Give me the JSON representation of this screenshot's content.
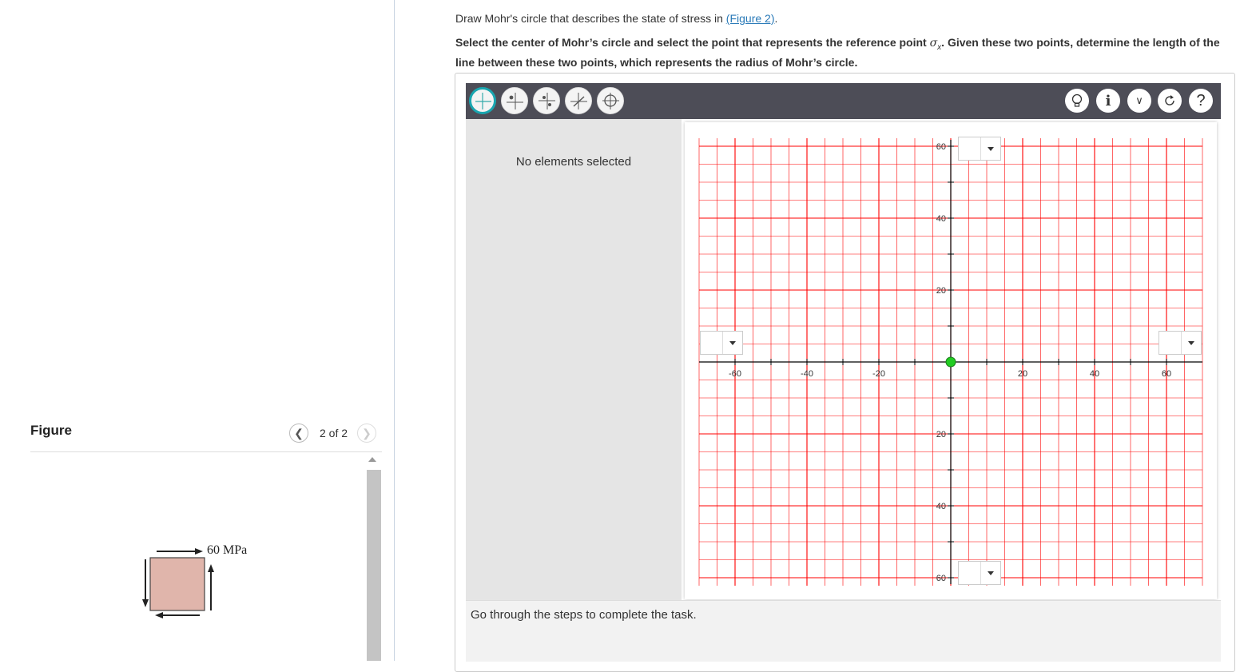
{
  "question": {
    "intro_before": "Draw Mohr's circle that describes the state of stress in ",
    "figure_link": "(Figure 2)",
    "intro_after": ".",
    "instruction_a": "Select the center of Mohr’s circle and select the point that represents the reference point ",
    "instruction_sym": "σ",
    "instruction_sub": "x",
    "instruction_b": ". Given these two points, determine the length of the line between these two points, which represents the radius of Mohr’s circle."
  },
  "figure_panel": {
    "title": "Figure",
    "counter": "2 of 2",
    "prev_icon": "chevron-left-icon",
    "next_icon": "chevron-right-icon",
    "stress_label": "60 MPa",
    "element_color": "#e0b5ab"
  },
  "toolbar": {
    "tools": [
      "axes-tool-icon",
      "point-tool-icon",
      "center-tool-icon",
      "segment-tool-icon",
      "circle-tool-icon"
    ],
    "right_tools": [
      "hint-bulb-icon",
      "info-icon",
      "chevron-down-icon",
      "reset-icon",
      "help-icon"
    ]
  },
  "side_panel": {
    "selection_text": "No elements selected"
  },
  "status": {
    "text": "Go through the steps to complete the task."
  },
  "graph": {
    "grid_color": "#ff0000",
    "point_color": "#22cc22",
    "x_ticks": [
      "-60",
      "-40",
      "-20",
      "20",
      "40",
      "60"
    ],
    "y_ticks_top": [
      "60",
      "40",
      "20"
    ],
    "y_ticks_bottom": [
      "20",
      "40",
      "60"
    ],
    "origin_point": [
      0,
      0
    ]
  }
}
